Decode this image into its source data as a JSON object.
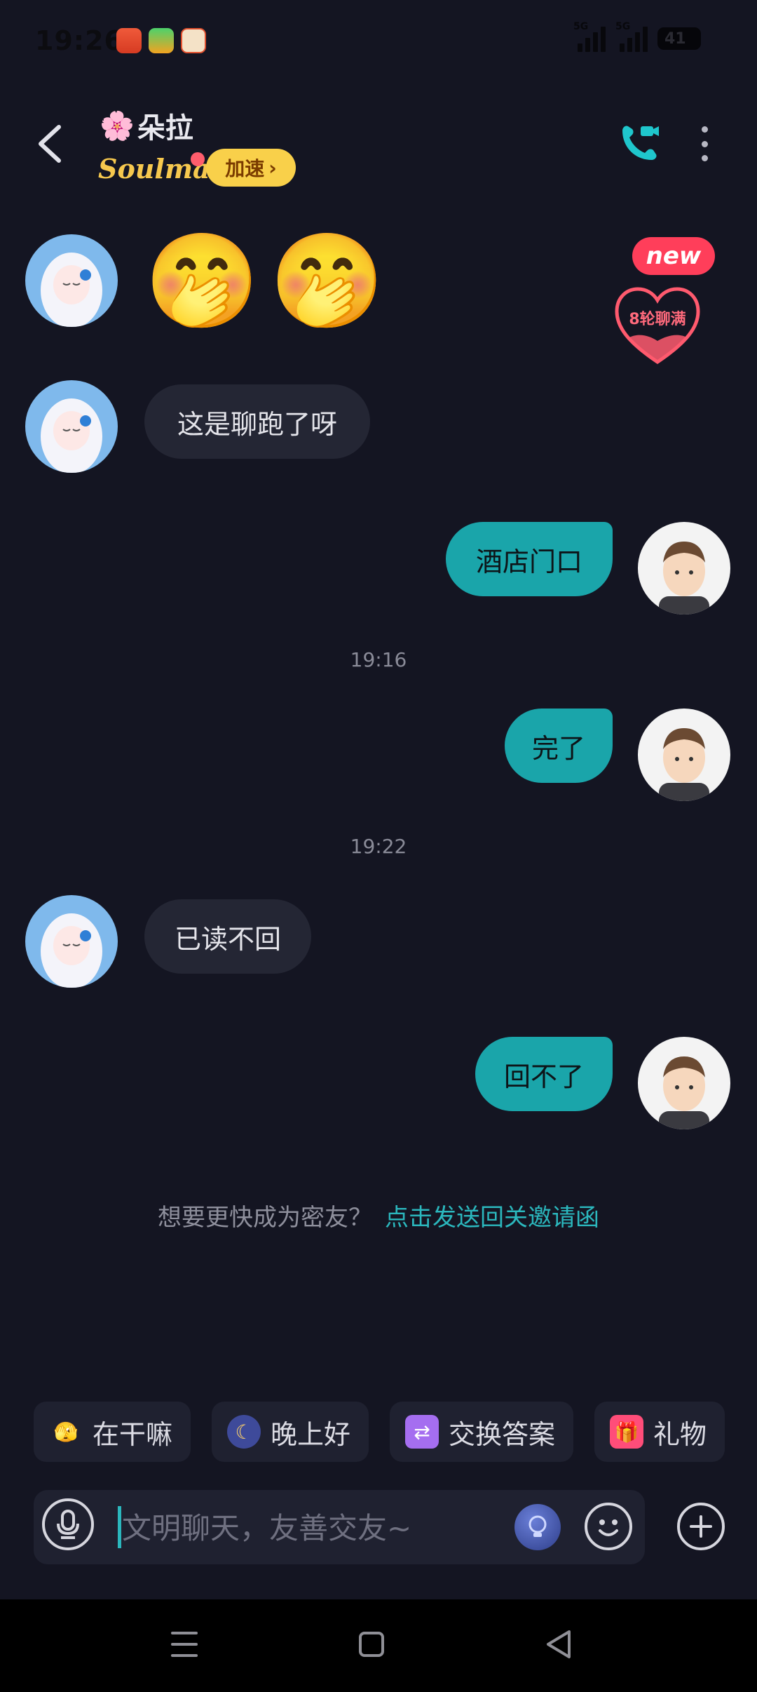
{
  "status_bar": {
    "time": "19:26",
    "signal1_label": "5G",
    "signal2_label": "5G",
    "battery": "41"
  },
  "header": {
    "title_flower": "🌸",
    "title": "朵拉",
    "soulmate": "Soulmate",
    "speed_label": "加速",
    "speed_arrow": "›"
  },
  "badges": {
    "new": "new",
    "heart": "8轮聊满"
  },
  "messages": [
    {
      "side": "in",
      "type": "emoji",
      "text": "🤭🤭"
    },
    {
      "side": "in",
      "type": "text",
      "text": "这是聊跑了呀"
    },
    {
      "side": "out",
      "type": "text",
      "text": "酒店门口"
    },
    {
      "side": "out",
      "type": "text",
      "text": "完了"
    },
    {
      "side": "in",
      "type": "text",
      "text": "已读不回"
    },
    {
      "side": "out",
      "type": "text",
      "text": "回不了"
    }
  ],
  "timestamps": [
    "19:16",
    "19:22"
  ],
  "invite": {
    "question": "想要更快成为密友？",
    "link": "点击发送回关邀请函"
  },
  "quick_replies": [
    {
      "icon": "face-peek-icon",
      "emoji": "🫣",
      "label": "在干嘛"
    },
    {
      "icon": "moon-face-icon",
      "emoji": "🌙",
      "label": "晚上好"
    },
    {
      "icon": "swap-icon",
      "emoji": "⇄",
      "label": "交换答案"
    },
    {
      "icon": "gift-icon",
      "emoji": "🎁",
      "label": "礼物"
    }
  ],
  "input": {
    "placeholder": "文明聊天，友善交友~"
  },
  "colors": {
    "background": "#141522",
    "accent": "#1aa5aa",
    "incoming_bubble": "#242634",
    "speed_badge": "#f9d04a",
    "new_badge": "#ff3e5a"
  }
}
